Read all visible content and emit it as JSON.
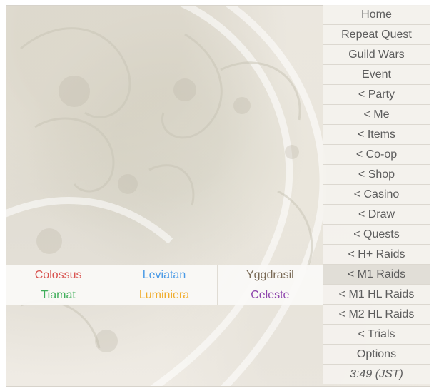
{
  "menu": {
    "items": [
      {
        "label": "Home"
      },
      {
        "label": "Repeat Quest"
      },
      {
        "label": "Guild Wars"
      },
      {
        "label": "Event"
      },
      {
        "label": "< Party"
      },
      {
        "label": "< Me"
      },
      {
        "label": "< Items"
      },
      {
        "label": "< Co-op"
      },
      {
        "label": "< Shop"
      },
      {
        "label": "< Casino"
      },
      {
        "label": "< Draw"
      },
      {
        "label": "< Quests"
      },
      {
        "label": "< H+ Raids"
      },
      {
        "label": "< M1 Raids",
        "active": true
      },
      {
        "label": "< M1 HL Raids"
      },
      {
        "label": "< M2 HL Raids"
      },
      {
        "label": "< Trials"
      },
      {
        "label": "Options"
      }
    ],
    "clock": "3:49 (JST)"
  },
  "submenu": {
    "rows": [
      [
        {
          "label": "Colossus",
          "color": "#d9534f"
        },
        {
          "label": "Leviatan",
          "color": "#4a9ae6"
        },
        {
          "label": "Yggdrasil",
          "color": "#7a6a56"
        }
      ],
      [
        {
          "label": "Tiamat",
          "color": "#3fae5a"
        },
        {
          "label": "Luminiera",
          "color": "#f0ad2e"
        },
        {
          "label": "Celeste",
          "color": "#8e44ad"
        }
      ]
    ]
  }
}
